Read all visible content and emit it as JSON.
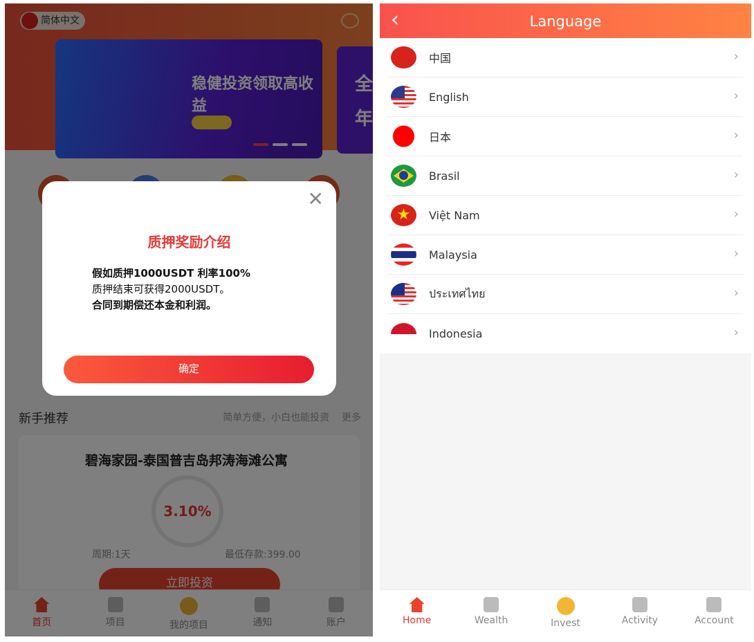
{
  "home": {
    "language_pill": "简体中文",
    "banner_title": "稳健投资领取高收益",
    "banner2_text": "全 年",
    "section_title": "新手推荐",
    "section_subtitle": "简单方便，小白也能投资",
    "section_more": "更多",
    "product": {
      "title": "碧海家园-泰国普吉岛邦涛海滩公寓",
      "rate": "3.10%",
      "period": "周期:1天",
      "min_deposit": "最低存款:399.00",
      "invest_label": "立即投资"
    },
    "tabs": [
      {
        "label": "首页",
        "icon": "home-icon",
        "active": true
      },
      {
        "label": "项目",
        "icon": "money-bag-icon"
      },
      {
        "label": "我的项目",
        "icon": "coins-icon"
      },
      {
        "label": "通知",
        "icon": "flag-icon"
      },
      {
        "label": "账户",
        "icon": "user-icon"
      }
    ]
  },
  "modal": {
    "title": "质押奖励介绍",
    "lines": [
      "假如质押1000USDT 利率100%",
      "质押结束可获得2000USDT。",
      "合同到期偿还本金和利润。"
    ],
    "confirm_label": "确定"
  },
  "language_page": {
    "title": "Language",
    "languages": [
      {
        "label": "中国",
        "flag": "china-flag"
      },
      {
        "label": "English",
        "flag": "us-flag"
      },
      {
        "label": "日本",
        "flag": "japan-flag"
      },
      {
        "label": "Brasil",
        "flag": "brazil-flag"
      },
      {
        "label": "Việt Nam",
        "flag": "vietnam-flag"
      },
      {
        "label": "Malaysia",
        "flag": "thailand-flag"
      },
      {
        "label": "ประเทศไทย",
        "flag": "malaysia-flag"
      },
      {
        "label": "Indonesia",
        "flag": "indonesia-flag"
      }
    ],
    "tabs": [
      {
        "label": "Home",
        "icon": "home-icon",
        "active": true
      },
      {
        "label": "Wealth",
        "icon": "money-bag-icon"
      },
      {
        "label": "Invest",
        "icon": "coins-icon"
      },
      {
        "label": "Activity",
        "icon": "flag-icon"
      },
      {
        "label": "Account",
        "icon": "user-icon"
      }
    ]
  },
  "colors": {
    "accent": "#e53935",
    "header_start": "#f9524d",
    "header_end": "#ff8343"
  }
}
